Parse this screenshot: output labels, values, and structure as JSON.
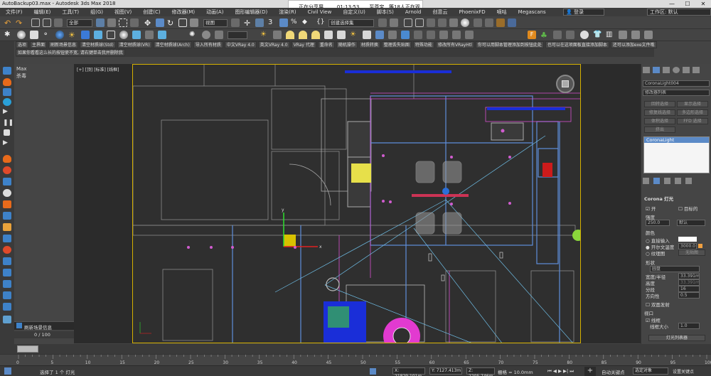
{
  "window": {
    "title": "AutoBackup03.max - Autodesk 3ds Max 2018"
  },
  "share_bar": {
    "status": "正在分享屏幕",
    "time": "01:13:53",
    "viewers": "至尊宝...等18人正在观看"
  },
  "menu": {
    "items": [
      "文件(F)",
      "编辑(E)",
      "工具(T)",
      "组(G)",
      "视图(V)",
      "创建(C)",
      "修改器(M)",
      "动画(A)",
      "图形编辑器(D)",
      "渲染(R)",
      "Civil View",
      "自定义(U)",
      "脚本(S)",
      "Arnold",
      "创意云",
      "PhoenixFD",
      "嘀咕",
      "Megascans"
    ]
  },
  "header_right": {
    "login_label": "登录",
    "workspace_label": "工作区: 默认"
  },
  "toolbar": {
    "filter_all": "全部",
    "view_dropdown": "视图",
    "selection_set": "创建选择集"
  },
  "shelf": {
    "row1": [
      "选项",
      "主界面",
      "刷新场景信息",
      "清空材质球(Std)",
      "清空材质球(VR)",
      "清空材质球(Arch)",
      "导入所有材质",
      "中文VRay 4.0",
      "英文VRay 4.0",
      "VRay 代理",
      "重命名",
      "随机操作",
      "材质转换",
      "整理丢失贴图",
      "特殊功能",
      "修改所有VRayHtl",
      "你可以用脚本管理添加到按钮此处",
      "也可以在这项面板直接添加脚本",
      "还可以添加exe文件哦"
    ],
    "row2_text": "如果你看看这么长的按钮使不宽, 请右键单击我并删除我"
  },
  "left_panel": {
    "max_label": "Max",
    "kill_label": "杀毒",
    "scene_info_btn": "刷新场景信息"
  },
  "viewport": {
    "label": "[+] [顶] [标准] [线框]"
  },
  "command_panel": {
    "object_name": "CoronaLight004",
    "modifier_list": "修改器列表",
    "buttons": [
      "回转选择",
      "显示选择",
      "修复线选择",
      "多边形选择",
      "体积选择",
      "FFD 选择",
      "挤出"
    ],
    "stack_item": "CoronaLight",
    "rollout_title": "Corona 灯光",
    "on_label": "开",
    "targeted_label": "目标的",
    "intensity_label": "强度",
    "intensity_value": "250.0",
    "intensity_unit": "默认",
    "color_label": "颜色",
    "direct_input": "直接输入",
    "kelvin_label": "开尔文温度",
    "kelvin_value": "3000.0",
    "texture_label": "纹理图",
    "texture_none": "无贴图",
    "shape_label": "形状",
    "shape_value": "圆盘",
    "width_label": "宽度/半径",
    "width_value": "33.391m",
    "height_label": "高度",
    "height_value": "33.391m",
    "segments_label": "分段",
    "segments_value": "16",
    "directionality_label": "方向性",
    "directionality_value": "0.5",
    "twosided_label": "双面发射",
    "viewport_label": "视口",
    "wire_label": "线框",
    "wire_size_label": "线框大小",
    "wire_size_value": "1.0",
    "lister_button": "灯光列表器"
  },
  "timeline": {
    "frame": "0 / 100"
  },
  "ruler": {
    "ticks": [
      "0",
      "5",
      "10",
      "15",
      "20",
      "25",
      "30",
      "35",
      "40",
      "45",
      "50",
      "55",
      "60",
      "65",
      "70",
      "75",
      "80",
      "85",
      "90",
      "95",
      "100"
    ]
  },
  "status": {
    "selected": "选择了 1 个 灯光",
    "x": "X: 21829.101m",
    "y": "Y: 7127.413m",
    "z": "Z: 2205.746m",
    "grid": "栅格 = 10.0mm",
    "autokey": "自动关键点",
    "selected_obj": "选定对象",
    "set_key": "设置关键点",
    "filters": "关键点过滤器"
  },
  "colors": {
    "accent": "#d5b000",
    "viewport_bg": "#2f2f2f",
    "selection_blue": "#1a2ed8",
    "magenta": "#e23ad0"
  }
}
